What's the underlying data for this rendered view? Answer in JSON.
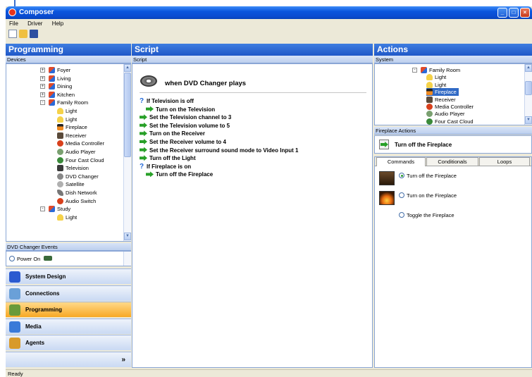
{
  "window": {
    "title": "Composer"
  },
  "menu": [
    "File",
    "Driver",
    "Help"
  ],
  "programming": {
    "header": "Programming",
    "devices_label": "Devices",
    "tree": [
      {
        "label": "Foyer",
        "icon": "room-icon",
        "indent": 1,
        "expander": "+"
      },
      {
        "label": "Living",
        "icon": "room-icon",
        "indent": 1,
        "expander": "+"
      },
      {
        "label": "Dining",
        "icon": "room-icon",
        "indent": 1,
        "expander": "+"
      },
      {
        "label": "Kitchen",
        "icon": "room-icon",
        "indent": 1,
        "expander": "+"
      },
      {
        "label": "Family Room",
        "icon": "room-icon",
        "indent": 1,
        "expander": "-"
      },
      {
        "label": "Light",
        "icon": "light-icon",
        "indent": 2
      },
      {
        "label": "Light",
        "icon": "light-icon",
        "indent": 2
      },
      {
        "label": "Fireplace",
        "icon": "fireplace-icon",
        "indent": 2
      },
      {
        "label": "Receiver",
        "icon": "receiver-icon",
        "indent": 2
      },
      {
        "label": "Media Controller",
        "icon": "media-controller-icon",
        "indent": 2
      },
      {
        "label": "Audio Player",
        "icon": "audio-player-icon",
        "indent": 2
      },
      {
        "label": "Four Cast Cloud",
        "icon": "cloud-icon",
        "indent": 2
      },
      {
        "label": "Television",
        "icon": "television-icon",
        "indent": 2
      },
      {
        "label": "DVD Changer",
        "icon": "dvd-icon",
        "indent": 2
      },
      {
        "label": "Satellite",
        "icon": "satellite-icon",
        "indent": 2
      },
      {
        "label": "Dish Network",
        "icon": "dish-icon",
        "indent": 2
      },
      {
        "label": "Audio Switch",
        "icon": "audio-switch-icon",
        "indent": 2
      },
      {
        "label": "Study",
        "icon": "room-icon",
        "indent": 1,
        "expander": "-"
      },
      {
        "label": "Light",
        "icon": "light-icon",
        "indent": 2
      }
    ],
    "events_label": "DVD Changer Events",
    "events": [
      {
        "label": "Power On"
      }
    ],
    "nav": [
      {
        "label": "System Design",
        "icon": "system-design-icon"
      },
      {
        "label": "Connections",
        "icon": "connections-icon"
      },
      {
        "label": "Programming",
        "icon": "programming-icon",
        "active": true
      },
      {
        "label": "Media",
        "icon": "media-icon"
      },
      {
        "label": "Agents",
        "icon": "agents-icon"
      }
    ],
    "more_glyph": "»"
  },
  "script": {
    "header": "Script",
    "sub": "Script",
    "trigger": "when DVD Changer plays",
    "lines": [
      {
        "text": "If Television is off",
        "type": "condition",
        "indent": 0
      },
      {
        "text": "Turn on the Television",
        "type": "action",
        "indent": 1
      },
      {
        "text": "Set the Television channel to 3",
        "type": "action",
        "indent": 0
      },
      {
        "text": "Set the Television volume to 5",
        "type": "action",
        "indent": 0
      },
      {
        "text": "Turn on the Receiver",
        "type": "action",
        "indent": 0
      },
      {
        "text": "Set the Receiver volume to 4",
        "type": "action",
        "indent": 0
      },
      {
        "text": "Set the Receiver surround sound mode to Video Input 1",
        "type": "action",
        "indent": 0
      },
      {
        "text": "Turn off the Light",
        "type": "action",
        "indent": 0
      },
      {
        "text": "If Fireplace is on",
        "type": "condition",
        "indent": 0
      },
      {
        "text": "Turn off the Fireplace",
        "type": "action",
        "indent": 1
      }
    ]
  },
  "actions": {
    "header": "Actions",
    "system_label": "System",
    "tree": [
      {
        "label": "Family Room",
        "icon": "room-icon",
        "indent": 0,
        "expander": "-"
      },
      {
        "label": "Light",
        "icon": "light-icon",
        "indent": 1
      },
      {
        "label": "Light",
        "icon": "light-icon",
        "indent": 1
      },
      {
        "label": "Fireplace",
        "icon": "fireplace-icon",
        "indent": 1,
        "selected": true
      },
      {
        "label": "Receiver",
        "icon": "receiver-icon",
        "indent": 1
      },
      {
        "label": "Media Controller",
        "icon": "media-controller-icon",
        "indent": 1
      },
      {
        "label": "Audio Player",
        "icon": "audio-player-icon",
        "indent": 1
      },
      {
        "label": "Four Cast Cloud",
        "icon": "cloud-icon",
        "indent": 1
      }
    ],
    "fireplace_actions_label": "Fireplace Actions",
    "current_action": "Turn off the Fireplace",
    "tabs": [
      "Commands",
      "Conditionals",
      "Loops"
    ],
    "commands": [
      {
        "label": "Turn off the Fireplace",
        "checked": true
      },
      {
        "label": "Turn on the Fireplace",
        "checked": false
      },
      {
        "label": "Toggle the Fireplace",
        "checked": false
      }
    ]
  },
  "status": {
    "text": "Ready"
  },
  "colors": {
    "header_blue": "#2058c8",
    "active_nav": "#f7a824",
    "arrow_green": "#28a028",
    "selected_row": "#316ac5"
  }
}
